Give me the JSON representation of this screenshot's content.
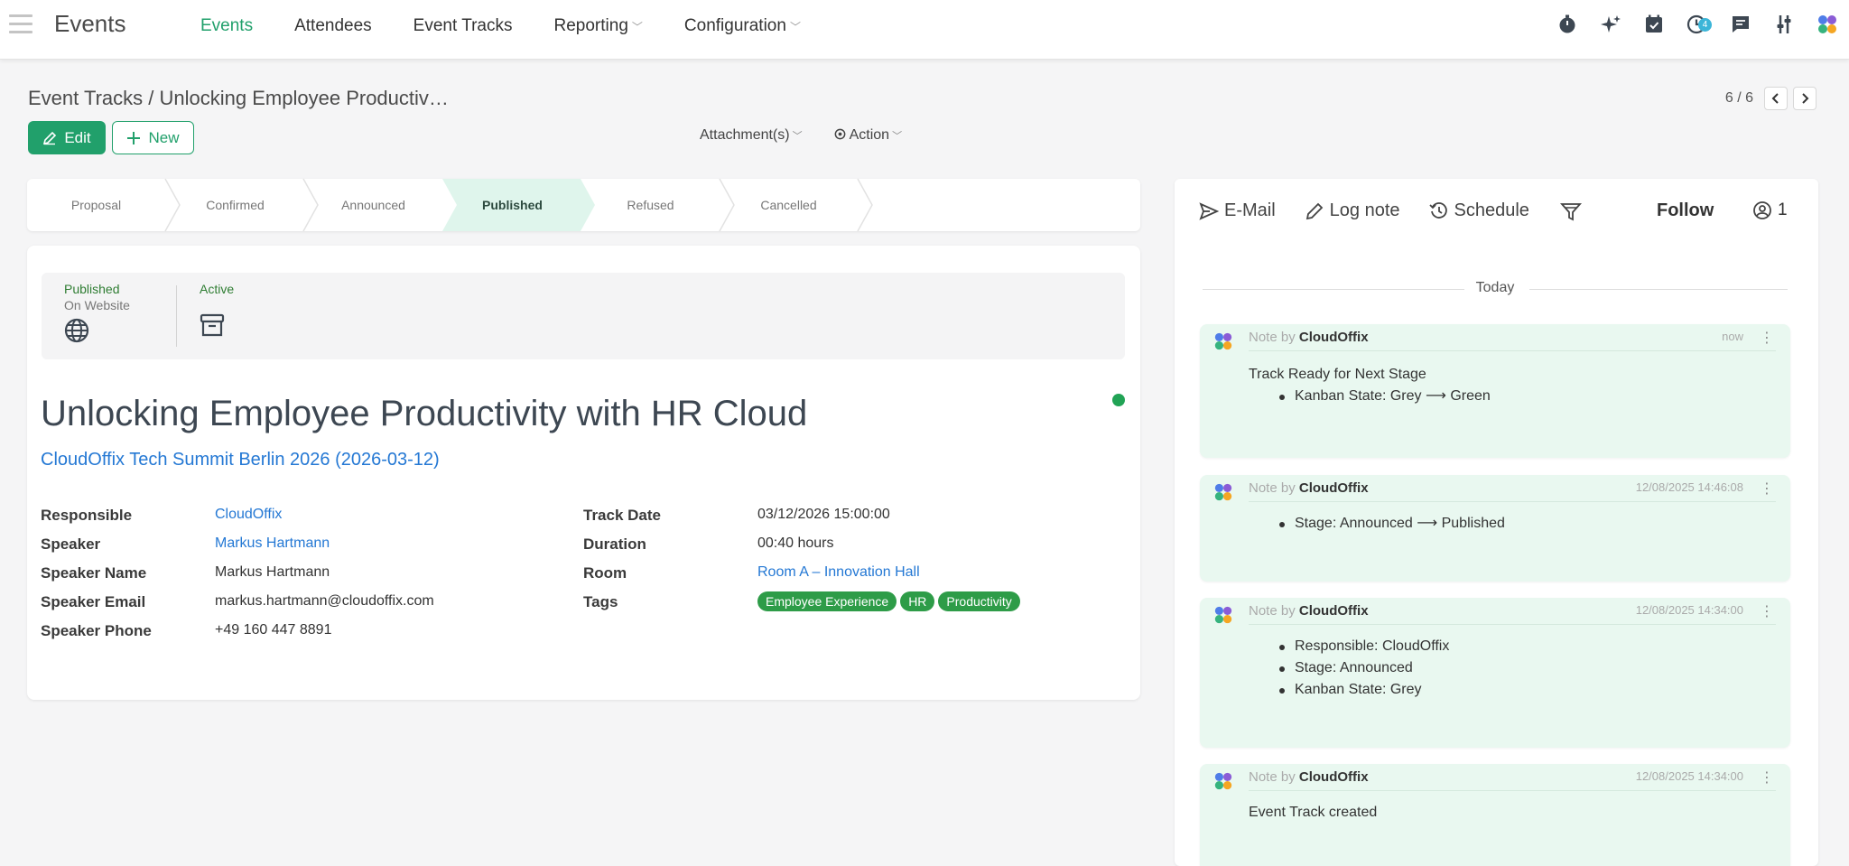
{
  "navbar": {
    "app_title": "Events",
    "menu": [
      {
        "label": "Events",
        "active": true
      },
      {
        "label": "Attendees"
      },
      {
        "label": "Event Tracks"
      },
      {
        "label": "Reporting",
        "caret": true
      },
      {
        "label": "Configuration",
        "caret": true
      }
    ],
    "icons": [
      "stopwatch-icon",
      "sparkle-icon",
      "calendar-check-icon",
      "activity-clock-icon",
      "chat-icon",
      "settings-sliders-icon",
      "apps-icon"
    ],
    "activity_count": "4"
  },
  "breadcrumb": {
    "parent": "Event Tracks",
    "separator": "/",
    "current": "Unlocking Employee Productiv…"
  },
  "pager": {
    "text": "6 / 6"
  },
  "actions": {
    "edit": "Edit",
    "new": "New",
    "attachments": "Attachment(s)",
    "action": "Action"
  },
  "stages": [
    {
      "label": "Proposal"
    },
    {
      "label": "Confirmed"
    },
    {
      "label": "Announced"
    },
    {
      "label": "Published",
      "active": true
    },
    {
      "label": "Refused"
    },
    {
      "label": "Cancelled"
    }
  ],
  "smart_buttons": {
    "published": {
      "line1": "Published",
      "line2": "On Website"
    },
    "active": {
      "line1": "Active"
    }
  },
  "record": {
    "title": "Unlocking Employee Productivity with HR Cloud",
    "event": "CloudOffix Tech Summit Berlin 2026 (2026-03-12)",
    "kanban_color": "#21a355",
    "left_fields": [
      {
        "label": "Responsible",
        "value": "CloudOffix",
        "link": true
      },
      {
        "label": "Speaker",
        "value": "Markus Hartmann",
        "link": true
      },
      {
        "label": "Speaker Name",
        "value": "Markus Hartmann"
      },
      {
        "label": "Speaker Email",
        "value": "markus.hartmann@cloudoffix.com"
      },
      {
        "label": "Speaker Phone",
        "value": "+49 160 447 8891"
      }
    ],
    "right_fields": [
      {
        "label": "Track Date",
        "value": "03/12/2026 15:00:00"
      },
      {
        "label": "Duration",
        "value": "00:40 hours"
      },
      {
        "label": "Room",
        "value": "Room A – Innovation Hall",
        "link": true
      },
      {
        "label": "Tags",
        "value": ""
      }
    ],
    "tags": [
      "Employee Experience",
      "HR",
      "Productivity"
    ]
  },
  "chatter": {
    "email": "E-Mail",
    "log_note": "Log note",
    "schedule": "Schedule",
    "follow": "Follow",
    "followers": "1",
    "date_separator": "Today",
    "messages": [
      {
        "prefix": "Note by",
        "author": "CloudOffix",
        "date": "now",
        "text": "Track Ready for Next Stage",
        "items": [
          "Kanban State: Grey ⟶ Green"
        ]
      },
      {
        "prefix": "Note by",
        "author": "CloudOffix",
        "date": "12/08/2025 14:46:08",
        "text": "",
        "items": [
          "Stage: Announced ⟶ Published"
        ]
      },
      {
        "prefix": "Note by",
        "author": "CloudOffix",
        "date": "12/08/2025 14:34:00",
        "text": "",
        "items": [
          "Responsible: CloudOffix",
          "Stage: Announced",
          "Kanban State: Grey"
        ]
      },
      {
        "prefix": "Note by",
        "author": "CloudOffix",
        "date": "12/08/2025 14:34:00",
        "text": "Event Track created",
        "items": []
      }
    ]
  },
  "colors": {
    "brand": "#21a06b",
    "link": "#2478d4",
    "tag": "#2e9c48",
    "note_bg": "#e9f8f0"
  }
}
